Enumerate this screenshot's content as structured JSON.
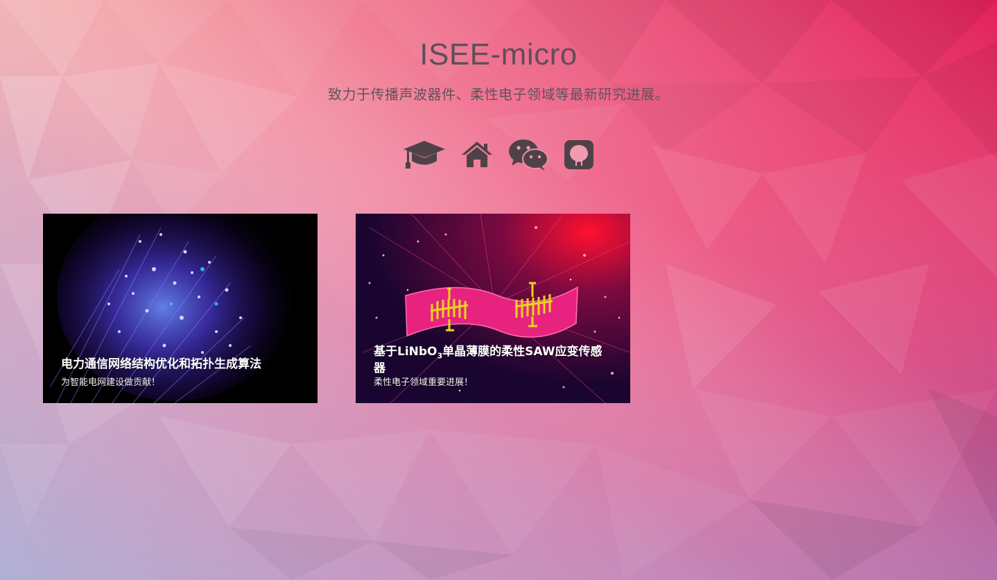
{
  "site": {
    "title": "ISEE-micro",
    "subtitle": "致力于传播声波器件、柔性电子领域等最新研究进展。"
  },
  "social": [
    {
      "icon": "graduation-cap-icon"
    },
    {
      "icon": "home-icon"
    },
    {
      "icon": "wechat-icon"
    },
    {
      "icon": "github-icon"
    }
  ],
  "posts": [
    {
      "title": "电力通信网络结构优化和拓扑生成算法",
      "desc": "为智能电网建设做贡献！"
    },
    {
      "title_prefix": "基于LiNbO",
      "title_sub": "3",
      "title_suffix": "单晶薄膜的柔性SAW应变传感器",
      "desc": "柔性电子领域重要进展！"
    }
  ],
  "colors": {
    "title_text": "#5d4f5a",
    "icon": "#4e4248",
    "card_text": "#ffffff"
  }
}
